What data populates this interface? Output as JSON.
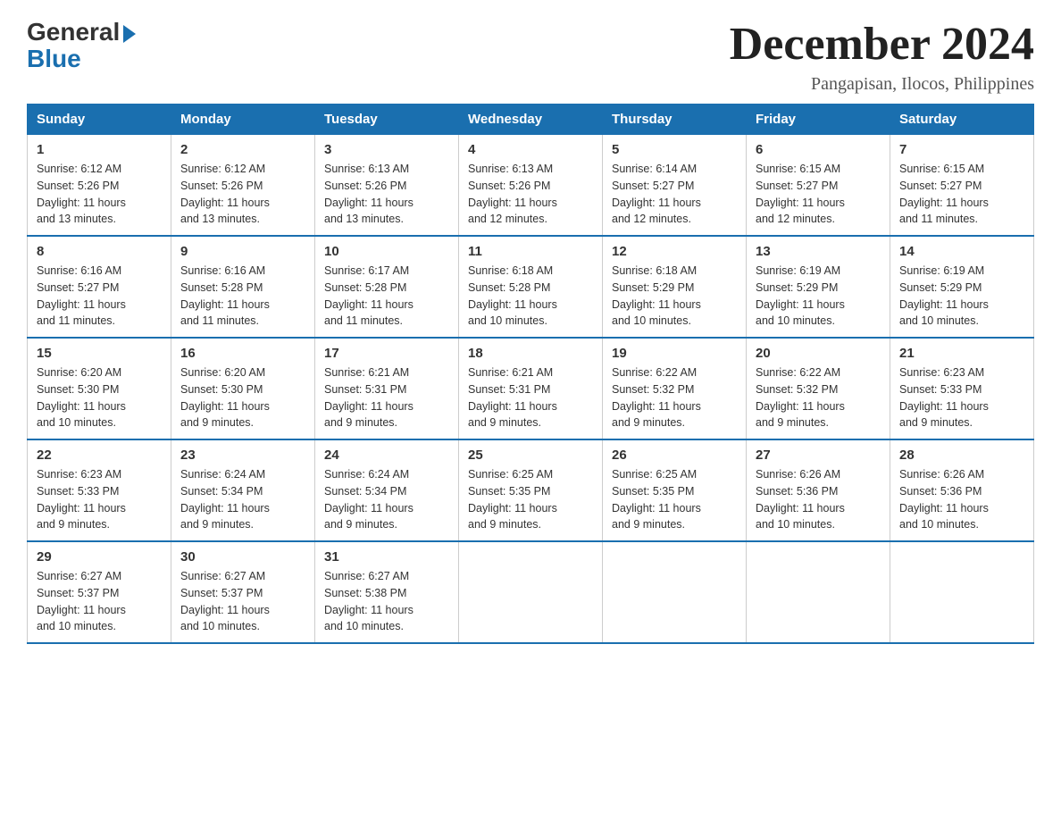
{
  "logo": {
    "general": "General",
    "blue": "Blue"
  },
  "title": "December 2024",
  "subtitle": "Pangapisan, Ilocos, Philippines",
  "days_of_week": [
    "Sunday",
    "Monday",
    "Tuesday",
    "Wednesday",
    "Thursday",
    "Friday",
    "Saturday"
  ],
  "weeks": [
    [
      {
        "day": "1",
        "sunrise": "6:12 AM",
        "sunset": "5:26 PM",
        "daylight": "11 hours and 13 minutes."
      },
      {
        "day": "2",
        "sunrise": "6:12 AM",
        "sunset": "5:26 PM",
        "daylight": "11 hours and 13 minutes."
      },
      {
        "day": "3",
        "sunrise": "6:13 AM",
        "sunset": "5:26 PM",
        "daylight": "11 hours and 13 minutes."
      },
      {
        "day": "4",
        "sunrise": "6:13 AM",
        "sunset": "5:26 PM",
        "daylight": "11 hours and 12 minutes."
      },
      {
        "day": "5",
        "sunrise": "6:14 AM",
        "sunset": "5:27 PM",
        "daylight": "11 hours and 12 minutes."
      },
      {
        "day": "6",
        "sunrise": "6:15 AM",
        "sunset": "5:27 PM",
        "daylight": "11 hours and 12 minutes."
      },
      {
        "day": "7",
        "sunrise": "6:15 AM",
        "sunset": "5:27 PM",
        "daylight": "11 hours and 11 minutes."
      }
    ],
    [
      {
        "day": "8",
        "sunrise": "6:16 AM",
        "sunset": "5:27 PM",
        "daylight": "11 hours and 11 minutes."
      },
      {
        "day": "9",
        "sunrise": "6:16 AM",
        "sunset": "5:28 PM",
        "daylight": "11 hours and 11 minutes."
      },
      {
        "day": "10",
        "sunrise": "6:17 AM",
        "sunset": "5:28 PM",
        "daylight": "11 hours and 11 minutes."
      },
      {
        "day": "11",
        "sunrise": "6:18 AM",
        "sunset": "5:28 PM",
        "daylight": "11 hours and 10 minutes."
      },
      {
        "day": "12",
        "sunrise": "6:18 AM",
        "sunset": "5:29 PM",
        "daylight": "11 hours and 10 minutes."
      },
      {
        "day": "13",
        "sunrise": "6:19 AM",
        "sunset": "5:29 PM",
        "daylight": "11 hours and 10 minutes."
      },
      {
        "day": "14",
        "sunrise": "6:19 AM",
        "sunset": "5:29 PM",
        "daylight": "11 hours and 10 minutes."
      }
    ],
    [
      {
        "day": "15",
        "sunrise": "6:20 AM",
        "sunset": "5:30 PM",
        "daylight": "11 hours and 10 minutes."
      },
      {
        "day": "16",
        "sunrise": "6:20 AM",
        "sunset": "5:30 PM",
        "daylight": "11 hours and 9 minutes."
      },
      {
        "day": "17",
        "sunrise": "6:21 AM",
        "sunset": "5:31 PM",
        "daylight": "11 hours and 9 minutes."
      },
      {
        "day": "18",
        "sunrise": "6:21 AM",
        "sunset": "5:31 PM",
        "daylight": "11 hours and 9 minutes."
      },
      {
        "day": "19",
        "sunrise": "6:22 AM",
        "sunset": "5:32 PM",
        "daylight": "11 hours and 9 minutes."
      },
      {
        "day": "20",
        "sunrise": "6:22 AM",
        "sunset": "5:32 PM",
        "daylight": "11 hours and 9 minutes."
      },
      {
        "day": "21",
        "sunrise": "6:23 AM",
        "sunset": "5:33 PM",
        "daylight": "11 hours and 9 minutes."
      }
    ],
    [
      {
        "day": "22",
        "sunrise": "6:23 AM",
        "sunset": "5:33 PM",
        "daylight": "11 hours and 9 minutes."
      },
      {
        "day": "23",
        "sunrise": "6:24 AM",
        "sunset": "5:34 PM",
        "daylight": "11 hours and 9 minutes."
      },
      {
        "day": "24",
        "sunrise": "6:24 AM",
        "sunset": "5:34 PM",
        "daylight": "11 hours and 9 minutes."
      },
      {
        "day": "25",
        "sunrise": "6:25 AM",
        "sunset": "5:35 PM",
        "daylight": "11 hours and 9 minutes."
      },
      {
        "day": "26",
        "sunrise": "6:25 AM",
        "sunset": "5:35 PM",
        "daylight": "11 hours and 9 minutes."
      },
      {
        "day": "27",
        "sunrise": "6:26 AM",
        "sunset": "5:36 PM",
        "daylight": "11 hours and 10 minutes."
      },
      {
        "day": "28",
        "sunrise": "6:26 AM",
        "sunset": "5:36 PM",
        "daylight": "11 hours and 10 minutes."
      }
    ],
    [
      {
        "day": "29",
        "sunrise": "6:27 AM",
        "sunset": "5:37 PM",
        "daylight": "11 hours and 10 minutes."
      },
      {
        "day": "30",
        "sunrise": "6:27 AM",
        "sunset": "5:37 PM",
        "daylight": "11 hours and 10 minutes."
      },
      {
        "day": "31",
        "sunrise": "6:27 AM",
        "sunset": "5:38 PM",
        "daylight": "11 hours and 10 minutes."
      },
      null,
      null,
      null,
      null
    ]
  ],
  "labels": {
    "sunrise": "Sunrise:",
    "sunset": "Sunset:",
    "daylight": "Daylight:"
  }
}
